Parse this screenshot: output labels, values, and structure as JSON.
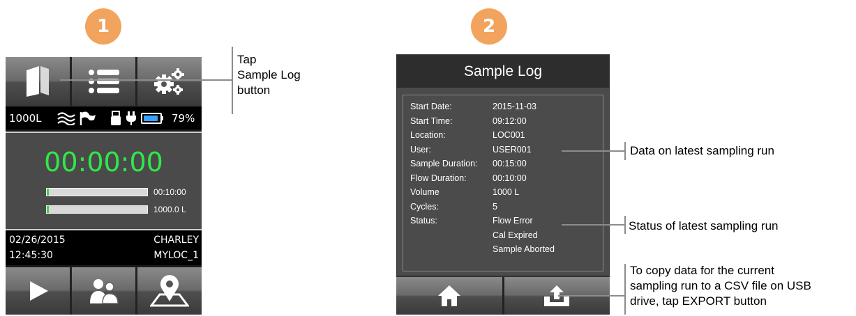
{
  "steps": {
    "step1": "1",
    "step2": "2"
  },
  "device1": {
    "status": {
      "volume": "1000L",
      "battery": "79%"
    },
    "timer": "00:00:00",
    "progress": [
      {
        "label": "00:10:00",
        "fraction": 0.02
      },
      {
        "label": "1000.0 L",
        "fraction": 0.02
      }
    ],
    "info": {
      "date": "02/26/2015",
      "time": "12:45:30",
      "user": "CHARLEY",
      "location": "MYLOC_1"
    },
    "icons": {
      "top": [
        "book-icon",
        "list-icon",
        "gears-icon"
      ],
      "bottom": [
        "play-icon",
        "users-icon",
        "map-pin-icon"
      ],
      "status": [
        "flow-icon",
        "flag-icon",
        "usb-icon",
        "plug-icon",
        "battery-icon"
      ]
    }
  },
  "device2": {
    "title": "Sample Log",
    "rows": [
      {
        "label": "Start Date:",
        "value": "2015-11-03"
      },
      {
        "label": "Start Time:",
        "value": "09:12:00"
      },
      {
        "label": "Location:",
        "value": "LOC001"
      },
      {
        "label": "User:",
        "value": "USER001"
      },
      {
        "label": "Sample Duration:",
        "value": "00:15:00"
      },
      {
        "label": "Flow Duration:",
        "value": "00:10:00"
      },
      {
        "label": "Volume",
        "value": "1000 L"
      },
      {
        "label": "Cycles:",
        "value": "5"
      },
      {
        "label": "Status:",
        "value": "Flow Error"
      },
      {
        "label": "",
        "value": "Cal Expired"
      },
      {
        "label": "",
        "value": "Sample Aborted"
      }
    ],
    "icons": {
      "bottom": [
        "home-icon",
        "export-icon"
      ]
    }
  },
  "callouts": {
    "tap_sample_log": [
      "Tap",
      "Sample Log",
      "button"
    ],
    "data_latest": "Data on latest sampling run",
    "status_latest": "Status of latest sampling run",
    "export": [
      "To copy data for the current",
      "sampling run to a CSV file on USB",
      "drive, tap EXPORT button"
    ]
  },
  "colors": {
    "badge": "#f2a35e",
    "timer": "#2fe84a",
    "progress_fill": "#39d24a"
  }
}
